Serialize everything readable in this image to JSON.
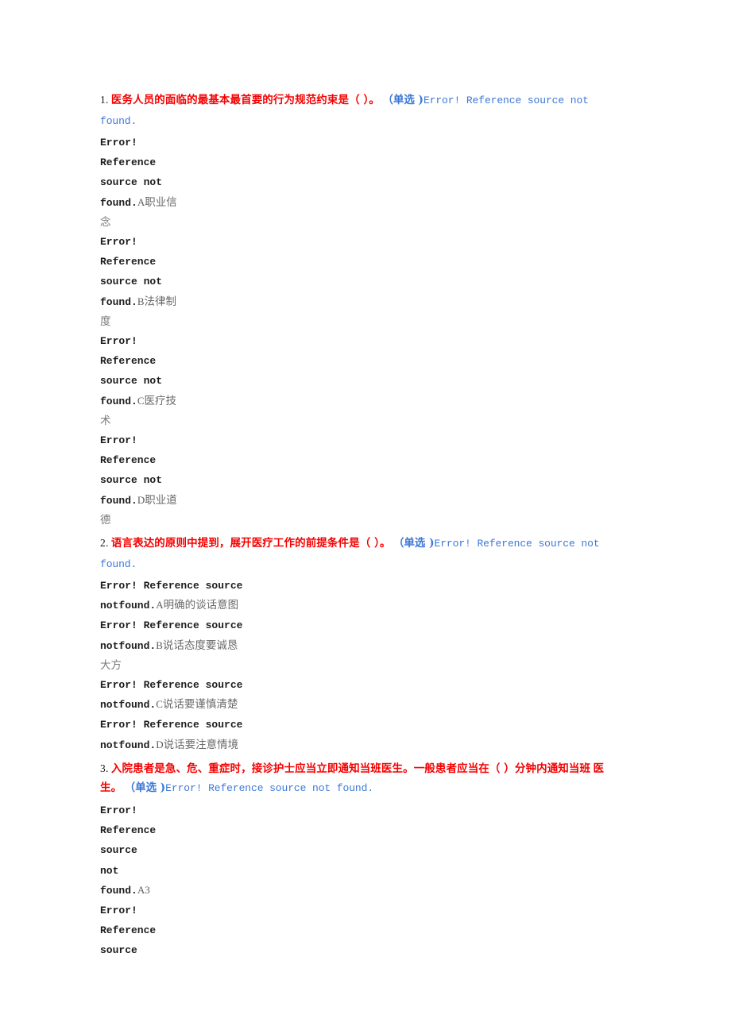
{
  "document": {
    "type": "exam-worksheet",
    "language": "zh-CN",
    "colors": {
      "question_red": "#f60000",
      "reference_blue": "#3c78d8",
      "body_black": "#1c1c1c",
      "option_gray": "#6a6a6a",
      "page_background": "#ffffff"
    },
    "broken_reference_text": "Error! Reference source not found."
  },
  "questions": [
    {
      "number": "1.",
      "text": "医务人员的面临的最基本最首要的行为规范约束是（ ）。",
      "type_label": "（单选 )",
      "ref_inline": "Error! Reference source not",
      "ref_wrap": "found.",
      "options": [
        {
          "lines": [
            "Error!",
            "Reference",
            "source not"
          ],
          "found_line": "found.",
          "label": "A",
          "cjk_first": "职业信",
          "cjk_cont": "念"
        },
        {
          "lines": [
            "Error!",
            "Reference",
            "source not"
          ],
          "found_line": "found.",
          "label": "B",
          "cjk_first": "法律制",
          "cjk_cont": "度"
        },
        {
          "lines": [
            "Error!",
            "Reference",
            "source not"
          ],
          "found_line": "found.",
          "label": "C",
          "cjk_first": "医疗技",
          "cjk_cont": "术"
        },
        {
          "lines": [
            "Error!",
            "Reference",
            "source not"
          ],
          "found_line": "found.",
          "label": "D",
          "cjk_first": "职业道",
          "cjk_cont": "德"
        }
      ]
    },
    {
      "number": "2.",
      "text": "语言表达的原则中提到，展开医疗工作的前提条件是（ ）。",
      "type_label": "（单选 )",
      "ref_inline": "Error! Reference source not",
      "ref_wrap": "found.",
      "options": [
        {
          "lines": [
            "Error! Reference source"
          ],
          "found_line": "notfound.",
          "label": "A",
          "cjk_first": "明确的谈话意图",
          "cjk_cont": ""
        },
        {
          "lines": [
            "Error! Reference source"
          ],
          "found_line": "notfound.",
          "label": "B",
          "cjk_first": "说话态度要诚恳",
          "cjk_cont": "大方"
        },
        {
          "lines": [
            "Error! Reference source"
          ],
          "found_line": "notfound.",
          "label": "C",
          "cjk_first": "说话要谨慎清楚",
          "cjk_cont": ""
        },
        {
          "lines": [
            "Error! Reference source"
          ],
          "found_line": "notfound.",
          "label": "D",
          "cjk_first": "说话要注意情境",
          "cjk_cont": ""
        }
      ]
    },
    {
      "number": "3.",
      "text": "入院患者是急、危、重症时，接诊护士应当立即通知当班医生。一般患者应当在（ ）分钟内通知当班",
      "text_line2": "医生。",
      "type_label": "（单选 )",
      "ref_inline": "Error! Reference source not found.",
      "ref_wrap": "",
      "options": [
        {
          "lines": [
            "Error!",
            "Reference",
            "source",
            "not"
          ],
          "found_line": "found.",
          "label": "A",
          "cjk_first": "3",
          "cjk_cont": ""
        },
        {
          "lines": [
            "Error!",
            "Reference",
            "source"
          ],
          "found_line": "",
          "label": "",
          "cjk_first": "",
          "cjk_cont": "",
          "truncated": true
        }
      ]
    }
  ]
}
